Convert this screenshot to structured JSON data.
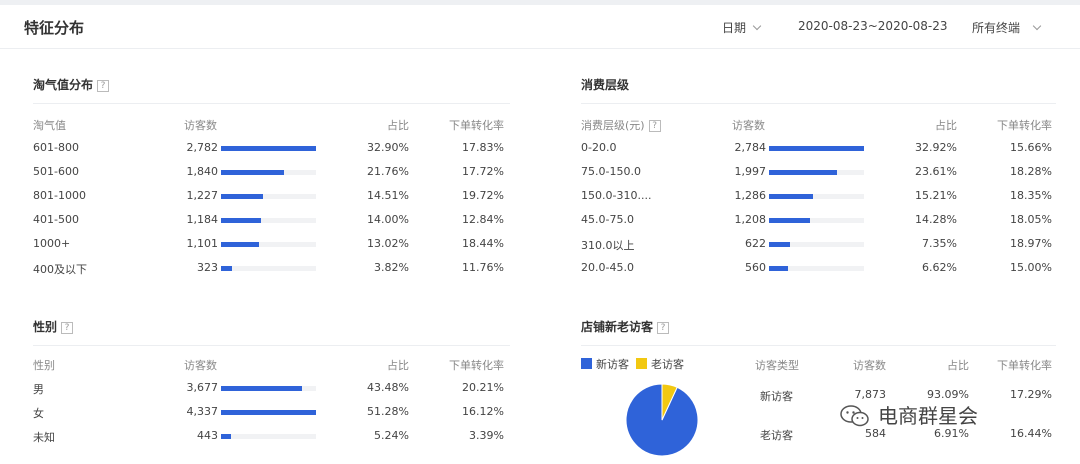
{
  "header": {
    "title": "特征分布",
    "date_label": "日期",
    "date_range": "2020-08-23~2020-08-23",
    "terminal": "所有终端"
  },
  "qi": {
    "title": "淘气值分布",
    "help": "?",
    "cols": [
      "淘气值",
      "访客数",
      "占比",
      "下单转化率"
    ],
    "rows": [
      {
        "label": "601-800",
        "visitors": "2,782",
        "share": "32.90%",
        "conv": "17.83%",
        "pct": 32.9
      },
      {
        "label": "501-600",
        "visitors": "1,840",
        "share": "21.76%",
        "conv": "17.72%",
        "pct": 21.76
      },
      {
        "label": "801-1000",
        "visitors": "1,227",
        "share": "14.51%",
        "conv": "19.72%",
        "pct": 14.51
      },
      {
        "label": "401-500",
        "visitors": "1,184",
        "share": "14.00%",
        "conv": "12.84%",
        "pct": 14.0
      },
      {
        "label": "1000+",
        "visitors": "1,101",
        "share": "13.02%",
        "conv": "18.44%",
        "pct": 13.02
      },
      {
        "label": "400及以下",
        "visitors": "323",
        "share": "3.82%",
        "conv": "11.76%",
        "pct": 3.82
      }
    ]
  },
  "consume": {
    "title": "消费层级",
    "cols": [
      "消费层级(元)",
      "访客数",
      "占比",
      "下单转化率"
    ],
    "help": "?",
    "rows": [
      {
        "label": "0-20.0",
        "visitors": "2,784",
        "share": "32.92%",
        "conv": "15.66%",
        "pct": 32.92
      },
      {
        "label": "75.0-150.0",
        "visitors": "1,997",
        "share": "23.61%",
        "conv": "18.28%",
        "pct": 23.61
      },
      {
        "label": "150.0-310....",
        "visitors": "1,286",
        "share": "15.21%",
        "conv": "18.35%",
        "pct": 15.21
      },
      {
        "label": "45.0-75.0",
        "visitors": "1,208",
        "share": "14.28%",
        "conv": "18.05%",
        "pct": 14.28
      },
      {
        "label": "310.0以上",
        "visitors": "622",
        "share": "7.35%",
        "conv": "18.97%",
        "pct": 7.35
      },
      {
        "label": "20.0-45.0",
        "visitors": "560",
        "share": "6.62%",
        "conv": "15.00%",
        "pct": 6.62
      }
    ]
  },
  "gender": {
    "title": "性别",
    "help": "?",
    "cols": [
      "性别",
      "访客数",
      "占比",
      "下单转化率"
    ],
    "rows": [
      {
        "label": "男",
        "visitors": "3,677",
        "share": "43.48%",
        "conv": "20.21%",
        "pct": 43.48
      },
      {
        "label": "女",
        "visitors": "4,337",
        "share": "51.28%",
        "conv": "16.12%",
        "pct": 51.28
      },
      {
        "label": "未知",
        "visitors": "443",
        "share": "5.24%",
        "conv": "3.39%",
        "pct": 5.24
      }
    ]
  },
  "newold": {
    "title": "店铺新老访客",
    "help": "?",
    "legend": [
      {
        "name": "新访客",
        "color": "#2f63d9"
      },
      {
        "name": "老访客",
        "color": "#f2c811"
      }
    ],
    "cols": [
      "访客类型",
      "访客数",
      "占比",
      "下单转化率"
    ],
    "rows": [
      {
        "label": "新访客",
        "visitors": "7,873",
        "share": "93.09%",
        "conv": "17.29%"
      },
      {
        "label": "老访客",
        "visitors": "584",
        "share": "6.91%",
        "conv": "16.44%"
      }
    ]
  },
  "chart_data": {
    "type": "pie",
    "categories": [
      "新访客",
      "老访客"
    ],
    "values": [
      93.09,
      6.91
    ],
    "colors": [
      "#2f63d9",
      "#f2c811"
    ],
    "title": "",
    "legend_position": "top-left"
  },
  "colors": {
    "bar": "#2f63d9",
    "track": "#f1f2f4"
  },
  "watermark": {
    "text": "电商群星会",
    "icon": "wechat-icon"
  }
}
